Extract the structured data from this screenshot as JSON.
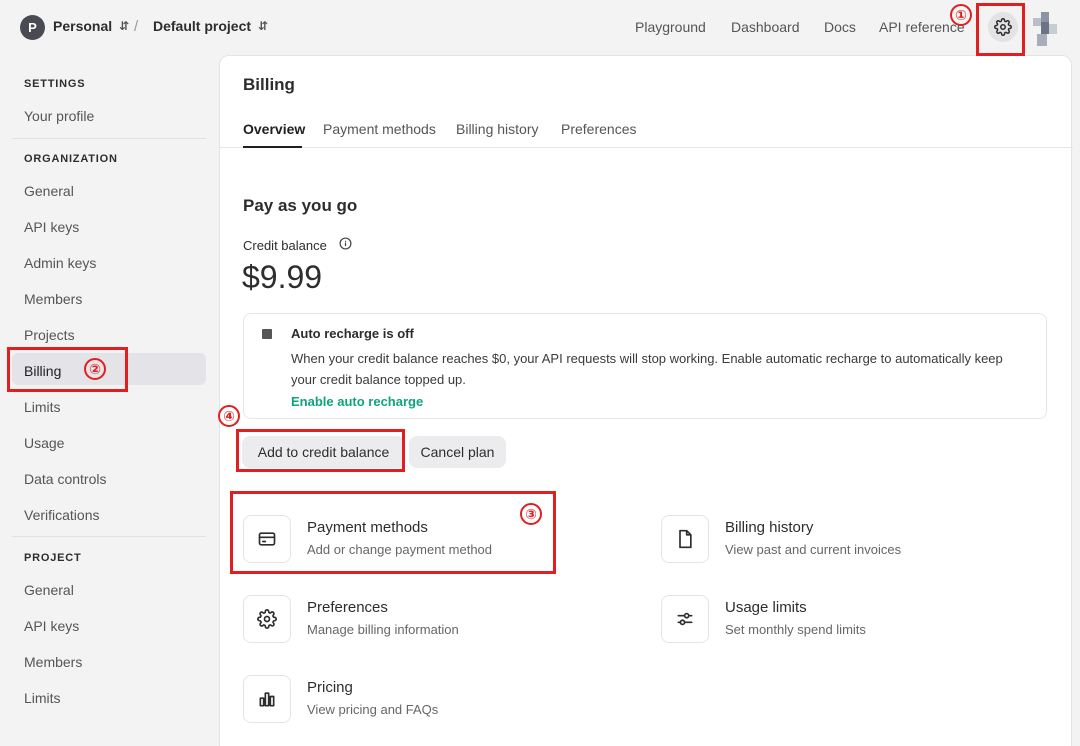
{
  "topbar": {
    "org_initial": "P",
    "org_name": "Personal",
    "project_name": "Default project",
    "separator": "/",
    "nav": [
      "Playground",
      "Dashboard",
      "Docs",
      "API reference"
    ]
  },
  "annotations": [
    "①",
    "②",
    "③",
    "④"
  ],
  "sidebar": {
    "settings_heading": "SETTINGS",
    "settings_items": [
      "Your profile"
    ],
    "organization_heading": "ORGANIZATION",
    "organization_items": [
      "General",
      "API keys",
      "Admin keys",
      "Members",
      "Projects",
      "Billing",
      "Limits",
      "Usage",
      "Data controls",
      "Verifications"
    ],
    "project_heading": "PROJECT",
    "project_items": [
      "General",
      "API keys",
      "Members",
      "Limits"
    ],
    "active_item": "Billing"
  },
  "main": {
    "title": "Billing",
    "tabs": [
      "Overview",
      "Payment methods",
      "Billing history",
      "Preferences"
    ],
    "active_tab": "Overview",
    "section_title": "Pay as you go",
    "credit_label": "Credit balance",
    "credit_balance": "$9.99",
    "notice": {
      "title": "Auto recharge is off",
      "body": "When your credit balance reaches $0, your API requests will stop working. Enable automatic recharge to automatically keep your credit balance topped up.",
      "link": "Enable auto recharge"
    },
    "buttons": {
      "add_credit": "Add to credit balance",
      "cancel_plan": "Cancel plan"
    },
    "cards": [
      {
        "title": "Payment methods",
        "subtitle": "Add or change payment method",
        "icon": "credit-card-icon"
      },
      {
        "title": "Billing history",
        "subtitle": "View past and current invoices",
        "icon": "document-icon"
      },
      {
        "title": "Preferences",
        "subtitle": "Manage billing information",
        "icon": "gear-icon"
      },
      {
        "title": "Usage limits",
        "subtitle": "Set monthly spend limits",
        "icon": "sliders-icon"
      },
      {
        "title": "Pricing",
        "subtitle": "View pricing and FAQs",
        "icon": "bar-chart-icon"
      }
    ]
  },
  "colors": {
    "accent_green": "#10a37f",
    "annotation_red": "#e02020"
  }
}
